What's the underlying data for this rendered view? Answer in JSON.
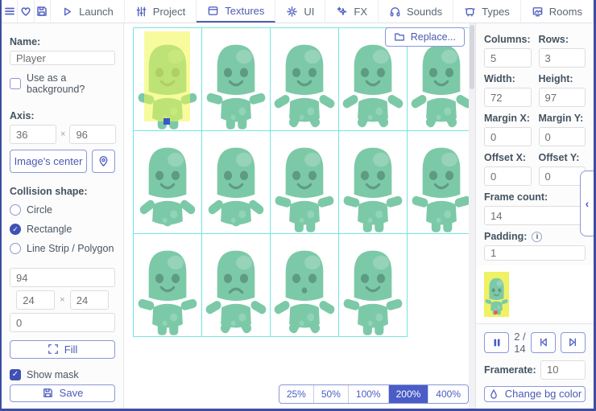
{
  "colors": {
    "accent": "#4a5ab3",
    "accent_strong": "#4a5cc5",
    "tab_underline": "#5460ab",
    "grid_line": "#72e6e2",
    "selection_yellow": "#f3f84d",
    "sprite_body": "#7cc9a8",
    "sprite_dark": "#5e9b82",
    "sprite_spot": "#9ad9bf",
    "preview_bg": "#eef263"
  },
  "icons": {
    "hamburger-icon": "≡",
    "heart-icon": "♡",
    "floppy-icon": "💾",
    "play-icon": "▷",
    "sliders-icon": "⫞",
    "frame-icon": "▣",
    "sparkle-icon": "✳",
    "fx-icon": "✦",
    "headphones-icon": "🎧",
    "ghost-icon": "👾",
    "rooms-icon": "🖼",
    "folder-icon": "📁",
    "pin-icon": "📍",
    "expand-icon": "⛶",
    "pause-icon": "⏸",
    "skip-back-icon": "⏮",
    "skip-forward-icon": "⏭",
    "droplet-icon": "💧",
    "info-icon": "ⓘ",
    "chevron-left-icon": "‹",
    "check-icon": "✓"
  },
  "toolbar": {
    "tabs": [
      {
        "label": "Launch",
        "active": false
      },
      {
        "label": "Project",
        "active": false
      },
      {
        "label": "Textures",
        "active": true
      },
      {
        "label": "UI",
        "active": false
      },
      {
        "label": "FX",
        "active": false
      },
      {
        "label": "Sounds",
        "active": false
      },
      {
        "label": "Types",
        "active": false
      },
      {
        "label": "Rooms",
        "active": false
      }
    ]
  },
  "left_panel": {
    "name_label": "Name:",
    "name_value": "Player",
    "use_background_label": "Use as a background?",
    "use_background_checked": false,
    "axis_label": "Axis:",
    "axis_x": "36",
    "axis_times": "×",
    "axis_y": "96",
    "images_center_label": "Image's center",
    "collision_label": "Collision shape:",
    "shape_options": [
      {
        "label": "Circle",
        "selected": false
      },
      {
        "label": "Rectangle",
        "selected": true
      },
      {
        "label": "Line Strip / Polygon",
        "selected": false
      }
    ],
    "rect_top": "94",
    "rect_left": "24",
    "rect_times": "×",
    "rect_right": "24",
    "rect_bottom": "0",
    "fill_label": "Fill",
    "show_mask_label": "Show mask",
    "show_mask_checked": true,
    "save_label": "Save"
  },
  "canvas": {
    "replace_label": "Replace...",
    "zoom_options": [
      "25%",
      "50%",
      "100%",
      "200%",
      "400%"
    ],
    "zoom_active": "200%",
    "grid": {
      "columns": 5,
      "rows": 3
    },
    "frames": [
      {
        "mouth": "smile",
        "pose": "stand",
        "selected": true
      },
      {
        "mouth": "smile",
        "pose": "stand",
        "selected": false
      },
      {
        "mouth": "smile",
        "pose": "spread",
        "selected": false
      },
      {
        "mouth": "smile",
        "pose": "spread",
        "selected": false
      },
      {
        "mouth": "smile",
        "pose": "spread",
        "selected": false
      },
      {
        "mouth": "smile",
        "pose": "point",
        "selected": false
      },
      {
        "mouth": "smile",
        "pose": "point",
        "selected": false
      },
      {
        "mouth": "smile",
        "pose": "stand",
        "selected": false
      },
      {
        "mouth": "smile",
        "pose": "stand",
        "selected": false
      },
      {
        "mouth": "smile",
        "pose": "stand",
        "selected": false
      },
      {
        "mouth": "smile",
        "pose": "stand",
        "selected": false
      },
      {
        "mouth": "frown",
        "pose": "spread",
        "selected": false
      },
      {
        "mouth": "o",
        "pose": "spread",
        "selected": false
      },
      {
        "mouth": "smile",
        "pose": "stand",
        "selected": false
      }
    ]
  },
  "right_panel": {
    "fields": [
      {
        "label": "Columns:",
        "value": "5"
      },
      {
        "label": "Rows:",
        "value": "3"
      },
      {
        "label": "Width:",
        "value": "72"
      },
      {
        "label": "Height:",
        "value": "97"
      },
      {
        "label": "Margin X:",
        "value": "0"
      },
      {
        "label": "Margin Y:",
        "value": "0"
      },
      {
        "label": "Offset X:",
        "value": "0"
      },
      {
        "label": "Offset Y:",
        "value": "0"
      }
    ],
    "frame_count_label": "Frame count:",
    "frame_count_value": "14",
    "padding_label": "Padding:",
    "padding_value": "1",
    "playback": {
      "counter": "2 / 14",
      "framerate_label": "Framerate:",
      "framerate_value": "10"
    },
    "change_bg_label": "Change bg color"
  }
}
